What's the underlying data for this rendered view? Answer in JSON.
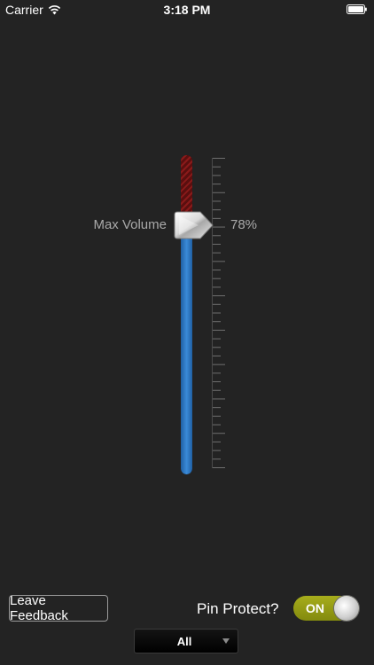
{
  "status_bar": {
    "carrier": "Carrier",
    "time": "3:18 PM",
    "icons": [
      "wifi-icon",
      "battery-icon"
    ]
  },
  "volume_slider": {
    "label": "Max Volume",
    "value_text": "78%",
    "value": 0.78,
    "tick_count": 36,
    "colors": {
      "filled": "#2f7fd0",
      "unfilled": "#7a1515"
    }
  },
  "footer": {
    "feedback_label": "Leave Feedback",
    "pin_protect_label": "Pin Protect?",
    "pin_toggle": {
      "state_text": "ON",
      "on": true,
      "color": "#9ba117"
    },
    "filter": {
      "selected": "All",
      "icon": "caret-down-icon"
    }
  }
}
